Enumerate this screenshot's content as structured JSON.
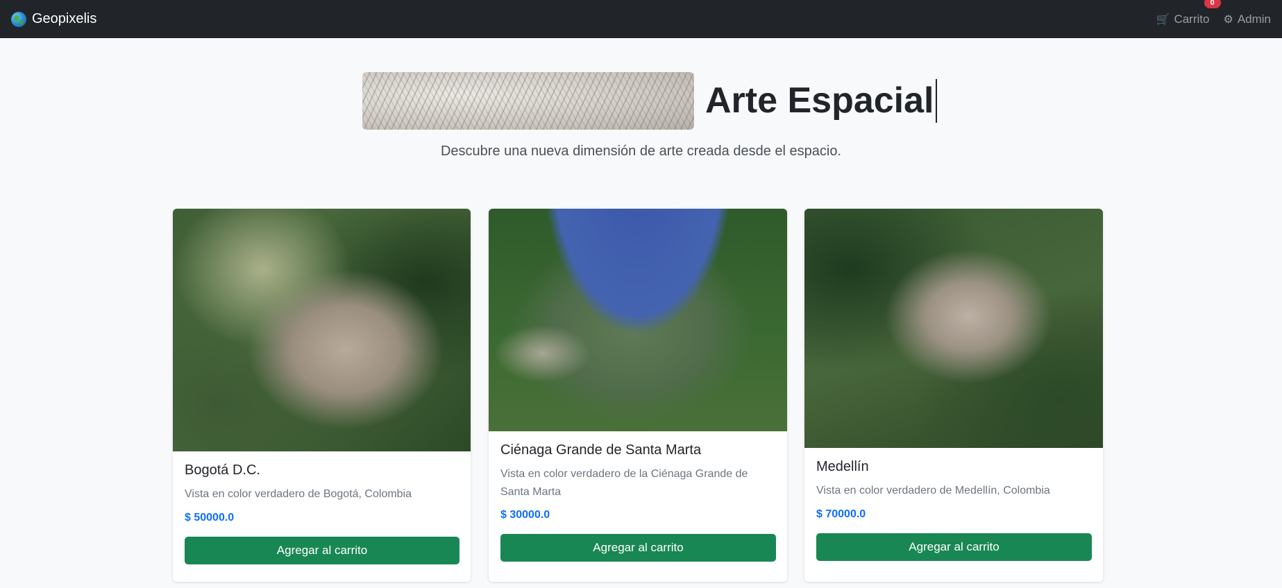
{
  "navbar": {
    "brand": "Geopixelis",
    "brand_icon": "globe-icon",
    "cart_label": "Carrito",
    "cart_count": "0",
    "admin_label": "Admin"
  },
  "hero": {
    "title": "Arte Espacial",
    "subtitle": "Descubre una nueva dimensión de arte creada desde el espacio."
  },
  "products": [
    {
      "title": "Bogotá D.C.",
      "description": "Vista en color verdadero de Bogotá, Colombia",
      "price": "$ 50000.0",
      "button": "Agregar al carrito"
    },
    {
      "title": "Ciénaga Grande de Santa Marta",
      "description": "Vista en color verdadero de la Ciénaga Grande de Santa Marta",
      "price": "$ 30000.0",
      "button": "Agregar al carrito"
    },
    {
      "title": "Medellín",
      "description": "Vista en color verdadero de Medellín, Colombia",
      "price": "$ 70000.0",
      "button": "Agregar al carrito"
    }
  ],
  "colors": {
    "navbar_bg": "#212529",
    "primary_price": "#0d6efd",
    "button_success": "#198754",
    "badge_danger": "#dc3545"
  }
}
